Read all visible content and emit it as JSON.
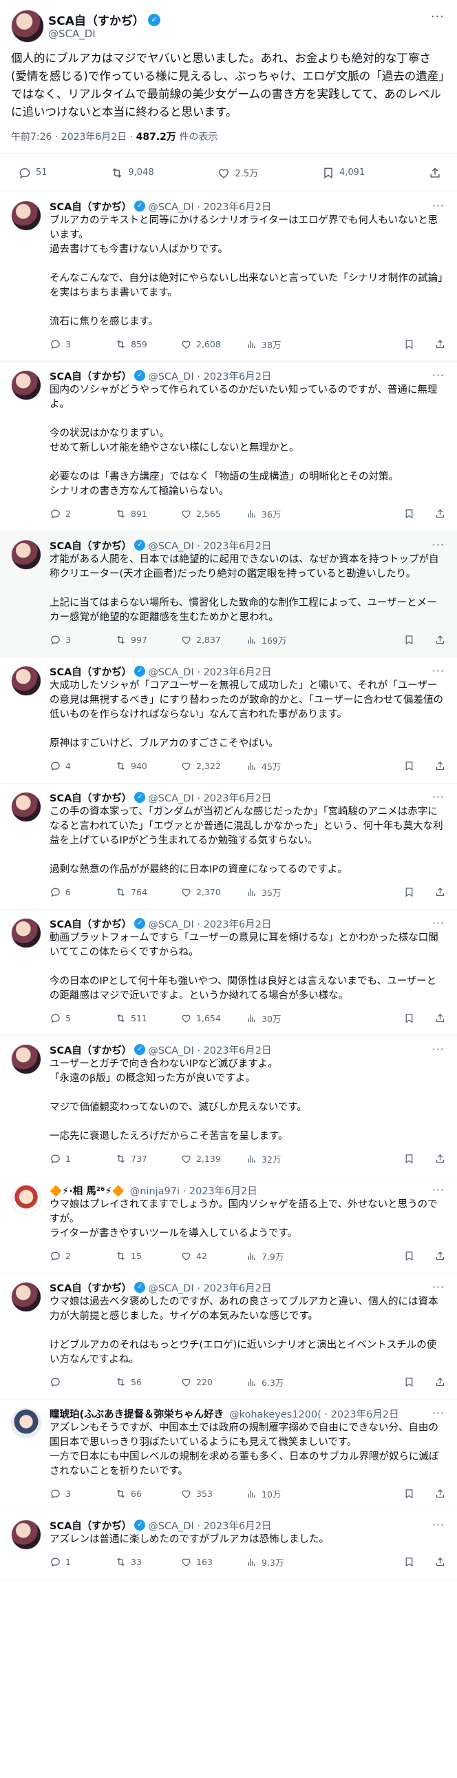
{
  "main_tweet": {
    "author": "SCA自（すかぢ）",
    "handle": "@SCA_DI",
    "text": "個人的にブルアカはマジでヤバいと思いました。あれ、お金よりも絶対的な丁寧さ(愛情を感じる)で作っている様に見えるし、ぶっちゃけ、エロゲ文脈の「過去の遺産」ではなく、リアルタイムで最前線の美少女ゲームの書き方を実践してて、あのレベルに追いつけないと本当に終わると思います。",
    "time": "午前7:26 · 2023年6月2日 · ",
    "views": "487.2万",
    "views_suffix": " 件の表示",
    "replies": "51",
    "retweets": "9,048",
    "likes": "2.5万",
    "bookmarks": "4,091"
  },
  "replies": [
    {
      "name": "SCA自（すかぢ）",
      "verified": true,
      "meta": "@SCA_DI · 2023年6月2日",
      "text": "ブルアカのテキストと同等にかけるシナリオライターはエロゲ界でも何人もいないと思います。\n過去書けても今書けない人ばかりです。\n\nそんなこんなで、自分は絶対にやらないし出来ないと言っていた「シナリオ制作の試論」を実はちまちま書いてます。\n\n流石に焦りを感じます。",
      "replies": "3",
      "retweets": "859",
      "likes": "2,608",
      "views": "38万"
    },
    {
      "name": "SCA自（すかぢ）",
      "verified": true,
      "meta": "@SCA_DI · 2023年6月2日",
      "text": "国内のソシャがどうやって作られているのかだいたい知っているのですが、普通に無理よ。\n\n今の状況はかなりまずい。\nせめて新しい才能を絶やさない様にしないと無理かと。\n\n必要なのは「書き方講座」ではなく「物語の生成構造」の明晰化とその対策。\nシナリオの書き方なんて極論いらない。",
      "replies": "2",
      "retweets": "891",
      "likes": "2,565",
      "views": "36万"
    },
    {
      "name": "SCA自（すかぢ）",
      "verified": true,
      "meta": "@SCA_DI · 2023年6月2日",
      "text": "才能がある人間を、日本では絶望的に起用できないのは、なぜか資本を持つトップが自称クリエーター(天才企画者)だったり絶対の鑑定眼を持っていると勘違いしたり。\n\n上記に当てはまらない場所も、慣習化した致命的な制作工程によって、ユーザーとメーカー感覚が絶望的な距離感を生むためかと思われ。",
      "replies": "3",
      "retweets": "997",
      "likes": "2,837",
      "views": "169万",
      "highlight": true
    },
    {
      "name": "SCA自（すかぢ）",
      "verified": true,
      "meta": "@SCA_DI · 2023年6月2日",
      "text": "大成功したソシャが「コアユーザーを無視して成功した」と嘯いて、それが「ユーザーの意見は無視するべき」にすり替わったのが致命的かと、「ユーザーに合わせて偏差値の低いものを作らなければならない」なんて言われた事があります。\n\n原神はすごいけど、ブルアカのすごさこそやばい。",
      "replies": "4",
      "retweets": "940",
      "likes": "2,322",
      "views": "45万"
    },
    {
      "name": "SCA自（すかぢ）",
      "verified": true,
      "meta": "@SCA_DI · 2023年6月2日",
      "text": "この手の資本家って、「ガンダムが当初どんな感じだったか」「宮崎駿のアニメは赤字になると言われていた」「エヴァとか普通に混乱しかなかった」という、何十年も莫大な利益を上げているIPがどう生まれてるか勉強する気すらない。\n\n過剰な熱意の作品がが最終的に日本IPの資産になってるのですよ。",
      "replies": "6",
      "retweets": "764",
      "likes": "2,370",
      "views": "35万"
    },
    {
      "name": "SCA自（すかぢ）",
      "verified": true,
      "meta": "@SCA_DI · 2023年6月2日",
      "text": "動画プラットフォームですら「ユーザーの意見に耳を傾けるな」とかわかった様な口聞いててこの体たらくですからね。\n\n今の日本のIPとして何十年も強いやつ、関係性は良好とは言えないまでも、ユーザーとの距離感はマジで近いですよ。というか拗れてる場合が多い様な。",
      "replies": "5",
      "retweets": "511",
      "likes": "1,654",
      "views": "30万"
    },
    {
      "name": "SCA自（すかぢ）",
      "verified": true,
      "meta": "@SCA_DI · 2023年6月2日",
      "text": "ユーザーとガチで向き合わないIPなど滅びますよ。\n「永遠のβ版」の概念知った方が良いですよ。\n\nマジで価値観変わってないので、滅びしか見えないです。\n\n一応先に衰退したえろげだからこそ苦言を呈します。",
      "replies": "1",
      "retweets": "737",
      "likes": "2,139",
      "views": "32万"
    },
    {
      "name": "🔶⚡·相 馬²⁶⚡🔶",
      "verified": false,
      "meta": "@ninja97i · 2023年6月2日",
      "text": "ウマ娘はプレイされてますでしょうか。国内ソシャゲを語る上で、外せないと思うのですが。\nライターが書きやすいツールを導入しているようです。",
      "replies": "2",
      "retweets": "15",
      "likes": "42",
      "views": "7.9万",
      "avatar": "a2"
    },
    {
      "name": "SCA自（すかぢ）",
      "verified": true,
      "meta": "@SCA_DI · 2023年6月2日",
      "text": "ウマ娘は過去ベタ褒めしたのですが、あれの良さってブルアカと違い、個人的には資本力が大前提と感じました。サイゲの本気みたいな感じです。\n\nけどブルアカのそれはもっとウチ(エロゲ)に近いシナリオと演出とイベントスチルの使い方なんですよね。",
      "replies": "",
      "retweets": "56",
      "likes": "220",
      "views": "6.3万"
    },
    {
      "name": "瞳琥珀(ふぶあき提督＆弥栄ちゃん好き",
      "verified": false,
      "meta": "@kohakeyes1200( · 2023年6月2日",
      "text": "アズレンもそうですが、中国本土では政府の規制雁字搦めで自由にできない分、自由の国日本で思いっきり羽ばたいているようにも見えて微笑ましいです。\n一方で日本にも中国レベルの規制を求める輩も多く、日本のサブカル界隈が奴らに滅ぼされないことを祈りたいです。",
      "replies": "3",
      "retweets": "66",
      "likes": "353",
      "views": "10万",
      "avatar": "a3"
    },
    {
      "name": "SCA自（すかぢ）",
      "verified": true,
      "meta": "@SCA_DI · 2023年6月2日",
      "text": "アズレンは普通に楽しめたのですがブルアカは恐怖しました。",
      "replies": "1",
      "retweets": "33",
      "likes": "163",
      "views": "9.3万"
    }
  ]
}
